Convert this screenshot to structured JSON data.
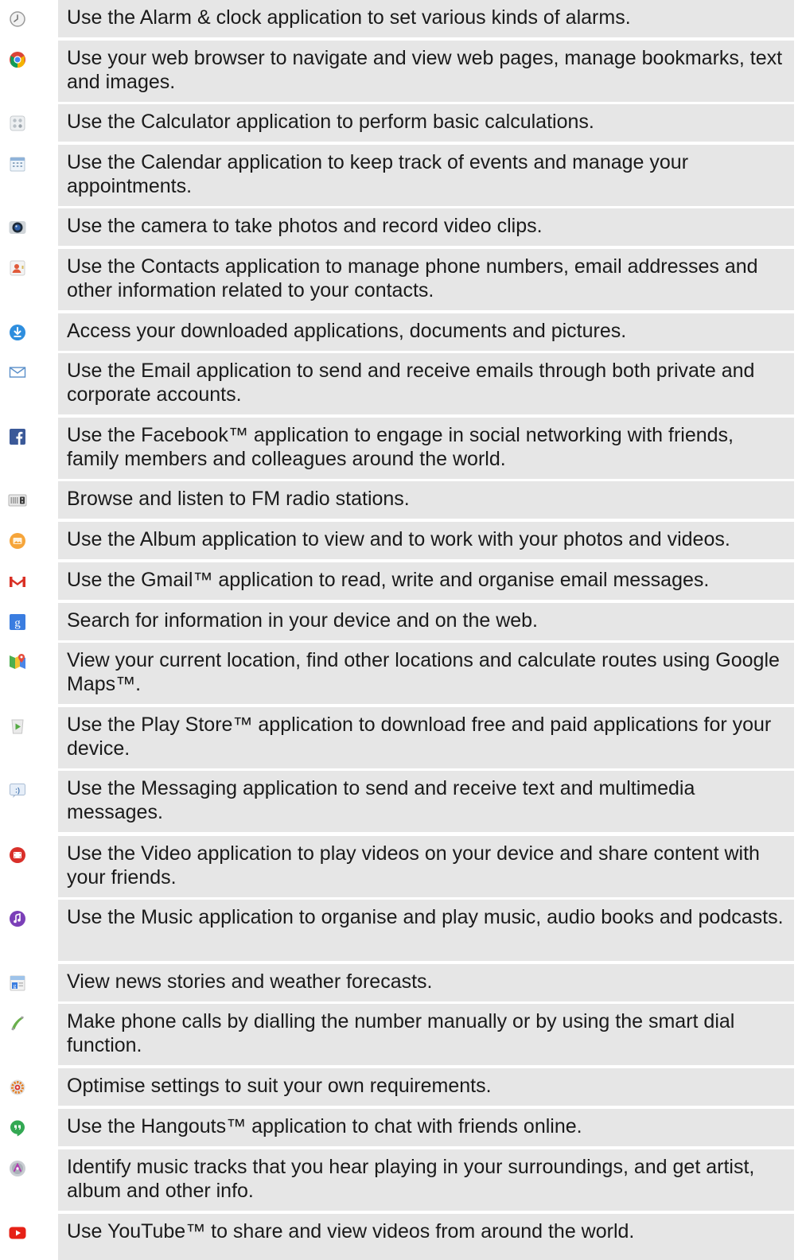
{
  "apps": [
    {
      "icon": "alarm-clock-icon",
      "text": "Use the Alarm & clock application to set various kinds of alarms."
    },
    {
      "icon": "chrome-browser-icon",
      "text": "Use your web browser to navigate and view web pages, manage bookmarks, text and images."
    },
    {
      "icon": "calculator-icon",
      "text": "Use the Calculator application to perform basic calculations."
    },
    {
      "icon": "calendar-icon",
      "text": "Use the Calendar application to keep track of events and manage your appointments."
    },
    {
      "icon": "camera-icon",
      "text": "Use the camera to take photos and record video clips."
    },
    {
      "icon": "contacts-icon",
      "text": "Use the Contacts application to manage phone numbers, email addresses and other information related to your contacts."
    },
    {
      "icon": "downloads-icon",
      "text": "Access your downloaded applications, documents and pictures."
    },
    {
      "icon": "email-icon",
      "text": "Use the Email application to send and receive emails through both private and corporate accounts."
    },
    {
      "icon": "facebook-icon",
      "text": "Use the Facebook™ application to engage in social networking with friends, family members and colleagues around the world."
    },
    {
      "icon": "fm-radio-icon",
      "text": "Browse and listen to FM radio stations."
    },
    {
      "icon": "album-icon",
      "text": "Use the Album application to view and to work with your photos and videos."
    },
    {
      "icon": "gmail-icon",
      "text": "Use the Gmail™ application to read, write and organise email messages."
    },
    {
      "icon": "google-search-icon",
      "text": "Search for information in your device and on the web."
    },
    {
      "icon": "google-maps-icon",
      "text": "View your current location, find other locations and calculate routes using Google Maps™."
    },
    {
      "icon": "play-store-icon",
      "text": "Use the Play Store™ application to download free and paid applications for your device."
    },
    {
      "icon": "messaging-icon",
      "text": "Use the Messaging application to send and receive text and multimedia messages."
    },
    {
      "icon": "video-icon",
      "text": "Use the Video application to play videos on your device and share content with your friends."
    },
    {
      "icon": "music-icon",
      "text": "Use the Music application to organise and play music, audio books and podcasts."
    },
    {
      "icon": "news-weather-icon",
      "text": "View news stories and weather forecasts."
    },
    {
      "icon": "phone-icon",
      "text": "Make phone calls by dialling the number manually or by using the smart dial function."
    },
    {
      "icon": "settings-icon",
      "text": "Optimise settings to suit your own requirements."
    },
    {
      "icon": "hangouts-icon",
      "text": "Use the Hangouts™ application to chat with friends online."
    },
    {
      "icon": "trackid-icon",
      "text": "Identify music tracks that you hear playing in your surroundings, and get artist, album and other info."
    },
    {
      "icon": "youtube-icon",
      "text": "Use YouTube™ to share and view videos from around the world."
    }
  ]
}
